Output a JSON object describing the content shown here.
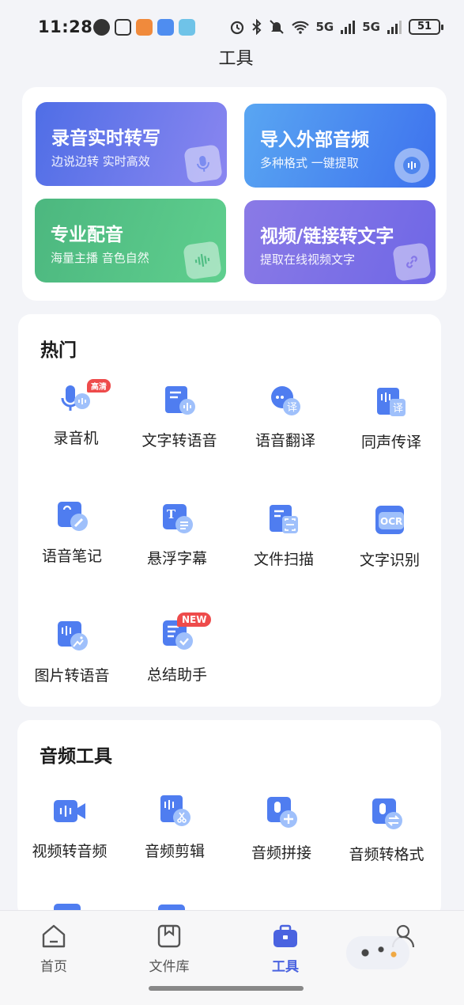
{
  "status_bar": {
    "time": "11:28",
    "network": "5G",
    "battery": "51"
  },
  "page": {
    "title": "工具"
  },
  "featured": [
    {
      "title": "录音实时转写",
      "subtitle": "边说边转 实时高效",
      "icon": "microphone-icon",
      "color": "#5b74e8"
    },
    {
      "title": "导入外部音频",
      "subtitle": "多种格式 一键提取",
      "icon": "audio-wave-icon",
      "color": "#4b8cf0"
    },
    {
      "title": "专业配音",
      "subtitle": "海量主播 音色自然",
      "icon": "voice-wave-icon",
      "color": "#4fbd83"
    },
    {
      "title": "视频/链接转文字",
      "subtitle": "提取在线视频文字",
      "icon": "link-icon",
      "color": "#7f72e8"
    }
  ],
  "hot": {
    "title": "热门",
    "items": [
      {
        "label": "录音机",
        "icon": "recorder-icon",
        "tag": "高清"
      },
      {
        "label": "文字转语音",
        "icon": "text-to-speech-icon"
      },
      {
        "label": "语音翻译",
        "icon": "voice-translate-icon"
      },
      {
        "label": "同声传译",
        "icon": "simultaneous-interpretation-icon"
      },
      {
        "label": "语音笔记",
        "icon": "voice-note-icon"
      },
      {
        "label": "悬浮字幕",
        "icon": "floating-subtitle-icon"
      },
      {
        "label": "文件扫描",
        "icon": "file-scan-icon"
      },
      {
        "label": "文字识别",
        "icon": "ocr-icon"
      },
      {
        "label": "图片转语音",
        "icon": "image-to-speech-icon"
      },
      {
        "label": "总结助手",
        "icon": "summary-assistant-icon",
        "tag": "NEW"
      }
    ]
  },
  "audio_tools": {
    "title": "音频工具",
    "items": [
      {
        "label": "视频转音频",
        "icon": "video-to-audio-icon"
      },
      {
        "label": "音频剪辑",
        "icon": "audio-cut-icon"
      },
      {
        "label": "音频拼接",
        "icon": "audio-merge-icon"
      },
      {
        "label": "音频转格式",
        "icon": "audio-convert-icon"
      }
    ]
  },
  "nav": [
    {
      "label": "首页",
      "icon": "home-icon"
    },
    {
      "label": "文件库",
      "icon": "file-library-icon"
    },
    {
      "label": "工具",
      "icon": "toolbox-icon",
      "active": true
    },
    {
      "label": "",
      "icon": "profile-icon"
    }
  ],
  "colors": {
    "accent": "#4a63e0",
    "icon_blue": "#4f7df0"
  }
}
